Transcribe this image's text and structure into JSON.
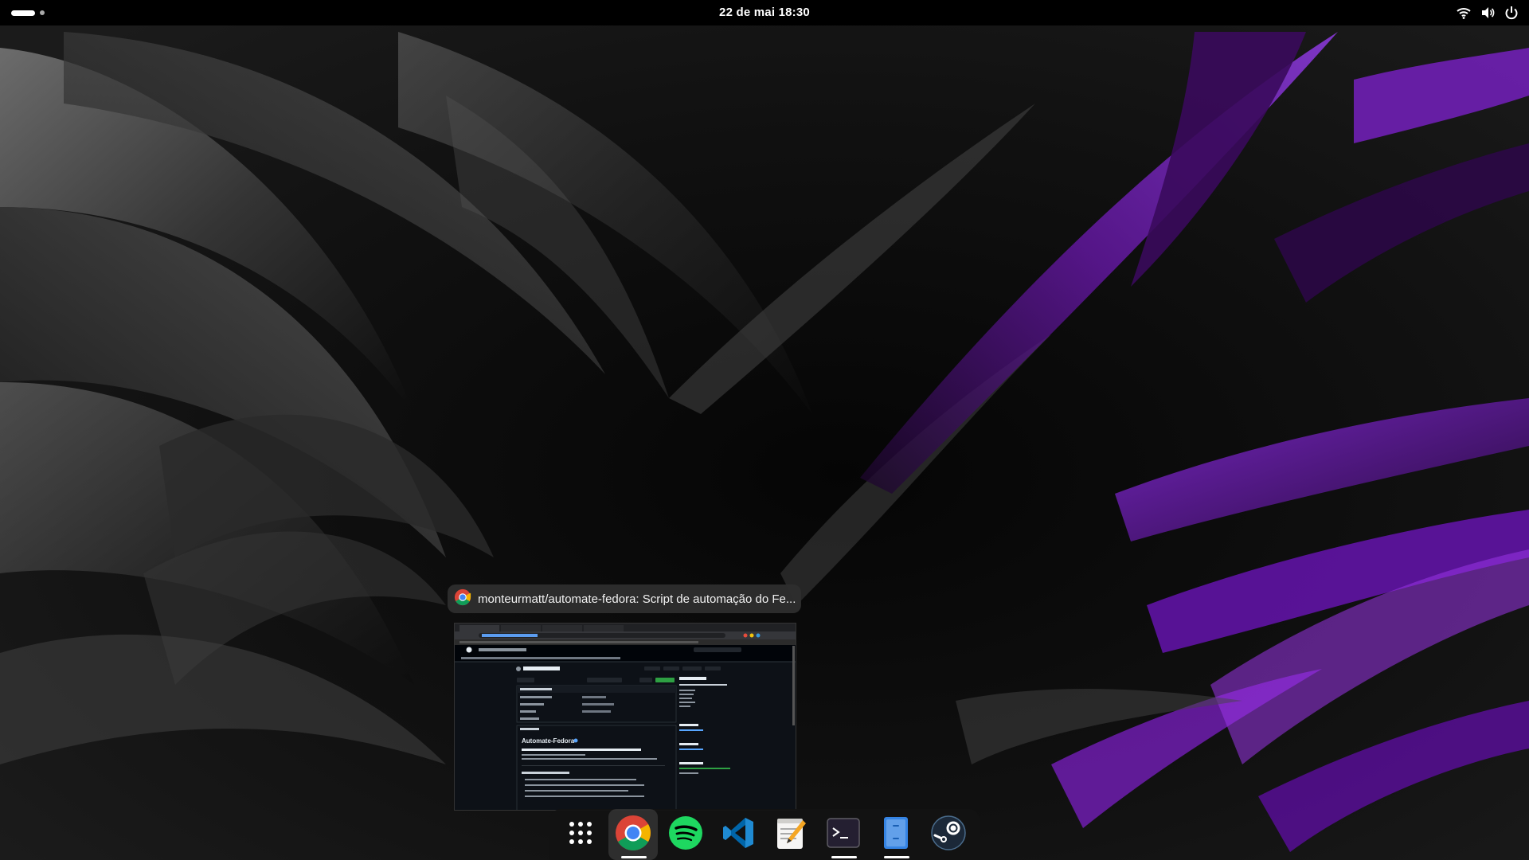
{
  "topbar": {
    "clock": "22 de mai  18:30"
  },
  "tray": {
    "icons": [
      "wifi-icon",
      "volume-icon",
      "power-icon"
    ]
  },
  "window_preview": {
    "title": "monteurmatt/automate-fedora: Script de automação do Fe...",
    "app_icon": "chrome-icon",
    "thumbnail": {
      "repo_title": "automate-fedora",
      "readme_heading": "Automate-Fedora",
      "description": "Script que realiza automações para instalação de apps via DNF, Flatpak e Snap",
      "about_heading": "About",
      "about_text": "Script de automação do Fedora Linux"
    }
  },
  "dock": {
    "items": [
      {
        "name": "app-grid",
        "icon": "app-grid-icon",
        "running": false
      },
      {
        "name": "chrome",
        "icon": "chrome-icon",
        "running": true
      },
      {
        "name": "spotify",
        "icon": "spotify-icon",
        "running": false
      },
      {
        "name": "vscode",
        "icon": "vscode-icon",
        "running": false
      },
      {
        "name": "text-editor",
        "icon": "text-editor-icon",
        "running": false
      },
      {
        "name": "terminal",
        "icon": "terminal-icon",
        "running": true
      },
      {
        "name": "files",
        "icon": "files-icon",
        "running": true
      },
      {
        "name": "steam",
        "icon": "steam-icon",
        "running": false
      }
    ]
  },
  "colors": {
    "accent_purple": "#7b1fc4",
    "topbar": "#000000",
    "github_bg": "#0d1117",
    "github_green": "#2ea043"
  }
}
